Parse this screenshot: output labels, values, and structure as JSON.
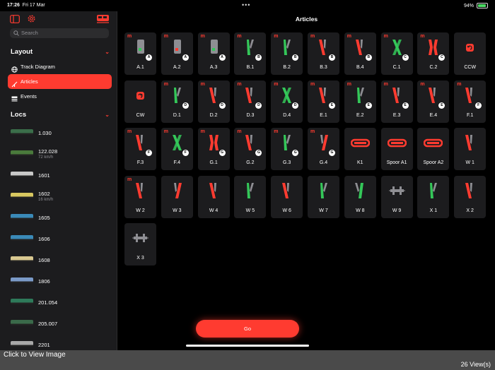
{
  "status": {
    "time": "17:26",
    "date": "Fri 17 Mar",
    "battery": "94%",
    "more_dots": "•••"
  },
  "colors": {
    "accent": "#ff3b30",
    "green": "#34c759",
    "gray": "#8e8e93",
    "tile": "#1c1c1e"
  },
  "sidebar": {
    "icons": [
      "sidebar-toggle-icon",
      "gear-icon",
      "locomotive-icon"
    ],
    "search_placeholder": "Search",
    "layout_header": "Layout",
    "layout_items": [
      {
        "label": "Track Diagram",
        "icon": "globe-icon",
        "active": false
      },
      {
        "label": "Articles",
        "icon": "switch-icon",
        "active": true
      },
      {
        "label": "Events",
        "icon": "list-icon",
        "active": false
      }
    ],
    "locs_header": "Locs",
    "locs": [
      {
        "name": "1.030",
        "speed": "",
        "color": "#3b6e4a"
      },
      {
        "name": "122.028",
        "speed": "72 km/h",
        "color": "#4a7a3c"
      },
      {
        "name": "1601",
        "speed": "",
        "color": "#c8c8c8"
      },
      {
        "name": "1602",
        "speed": "16 km/h",
        "color": "#d8c860"
      },
      {
        "name": "1605",
        "speed": "",
        "color": "#3a8ab8"
      },
      {
        "name": "1606",
        "speed": "",
        "color": "#3a8ab8"
      },
      {
        "name": "1608",
        "speed": "",
        "color": "#d8c890"
      },
      {
        "name": "1806",
        "speed": "",
        "color": "#7a9ac8"
      },
      {
        "name": "201.054",
        "speed": "",
        "color": "#2e7a5a"
      },
      {
        "name": "205.007",
        "speed": "",
        "color": "#3a6a4a"
      },
      {
        "name": "2201",
        "speed": "",
        "color": "#a8a8a8"
      }
    ]
  },
  "main": {
    "title": "Articles",
    "go_label": "Go",
    "articles": [
      {
        "label": "A.1",
        "m": "m",
        "badge": "A",
        "glyph": "signal-green"
      },
      {
        "label": "A.2",
        "m": "m",
        "badge": "A",
        "glyph": "signal-red"
      },
      {
        "label": "A.3",
        "m": "m",
        "badge": "A",
        "glyph": "signal-green"
      },
      {
        "label": "B.1",
        "m": "m",
        "badge": "B",
        "glyph": "turnout-green-right"
      },
      {
        "label": "B.2",
        "m": "m",
        "badge": "B",
        "glyph": "turnout-green-right"
      },
      {
        "label": "B.3",
        "m": "m",
        "badge": "B",
        "glyph": "turnout-red-left"
      },
      {
        "label": "B.4",
        "m": "m",
        "badge": "B",
        "glyph": "turnout-red-left"
      },
      {
        "label": "C.1",
        "m": "m",
        "badge": "C",
        "glyph": "cross-green"
      },
      {
        "label": "C.2",
        "m": "m",
        "badge": "C",
        "glyph": "cross-red"
      },
      {
        "label": "CCW",
        "m": "",
        "badge": "",
        "glyph": "rotate-ccw"
      },
      {
        "label": "CW",
        "m": "",
        "badge": "",
        "glyph": "rotate-cw"
      },
      {
        "label": "D.1",
        "m": "m",
        "badge": "D",
        "glyph": "turnout-green-right"
      },
      {
        "label": "D.2",
        "m": "m",
        "badge": "D",
        "glyph": "turnout-red-left"
      },
      {
        "label": "D.3",
        "m": "m",
        "badge": "D",
        "glyph": "turnout-red-left"
      },
      {
        "label": "D.4",
        "m": "m",
        "badge": "D",
        "glyph": "cross-green"
      },
      {
        "label": "E.1",
        "m": "m",
        "badge": "E",
        "glyph": "turnout-red-left"
      },
      {
        "label": "E.2",
        "m": "m",
        "badge": "E",
        "glyph": "turnout-green-right"
      },
      {
        "label": "E.3",
        "m": "m",
        "badge": "E",
        "glyph": "turnout-red-left"
      },
      {
        "label": "E.4",
        "m": "m",
        "badge": "E",
        "glyph": "turnout-red-left"
      },
      {
        "label": "F.1",
        "m": "m",
        "badge": "F",
        "glyph": "turnout-red-left"
      },
      {
        "label": "F.3",
        "m": "m",
        "badge": "F",
        "glyph": "turnout-red-left"
      },
      {
        "label": "F.4",
        "m": "m",
        "badge": "F",
        "glyph": "cross-green"
      },
      {
        "label": "G.1",
        "m": "m",
        "badge": "G",
        "glyph": "cross-red"
      },
      {
        "label": "G.2",
        "m": "m",
        "badge": "G",
        "glyph": "turnout-red-left"
      },
      {
        "label": "G.3",
        "m": "m",
        "badge": "G",
        "glyph": "turnout-green-right"
      },
      {
        "label": "G.4",
        "m": "m",
        "badge": "G",
        "glyph": "turnout-red-right"
      },
      {
        "label": "K1",
        "m": "",
        "badge": "",
        "glyph": "turntable"
      },
      {
        "label": "Spoor A1",
        "m": "",
        "badge": "",
        "glyph": "turntable"
      },
      {
        "label": "Spoor A2",
        "m": "",
        "badge": "",
        "glyph": "turntable"
      },
      {
        "label": "W 1",
        "m": "",
        "badge": "",
        "glyph": "turnout-red-left"
      },
      {
        "label": "W 2",
        "m": "m",
        "badge": "",
        "glyph": "turnout-red-left"
      },
      {
        "label": "W 3",
        "m": "",
        "badge": "",
        "glyph": "turnout-red-right"
      },
      {
        "label": "W 4",
        "m": "",
        "badge": "",
        "glyph": "turnout-red-left"
      },
      {
        "label": "W 5",
        "m": "",
        "badge": "",
        "glyph": "turnout-green-right"
      },
      {
        "label": "W 6",
        "m": "",
        "badge": "",
        "glyph": "turnout-red-left"
      },
      {
        "label": "W 7",
        "m": "",
        "badge": "",
        "glyph": "turnout-green-right"
      },
      {
        "label": "W 8",
        "m": "",
        "badge": "",
        "glyph": "turnout-green-left"
      },
      {
        "label": "W 9",
        "m": "",
        "badge": "",
        "glyph": "uncoupler"
      },
      {
        "label": "X 1",
        "m": "",
        "badge": "",
        "glyph": "turnout-green-right"
      },
      {
        "label": "X 2",
        "m": "",
        "badge": "",
        "glyph": "turnout-red-left"
      },
      {
        "label": "X 3",
        "m": "",
        "badge": "",
        "glyph": "uncoupler"
      }
    ]
  },
  "footer": {
    "cta": "Click to View Image",
    "views": "26 View(s)"
  }
}
